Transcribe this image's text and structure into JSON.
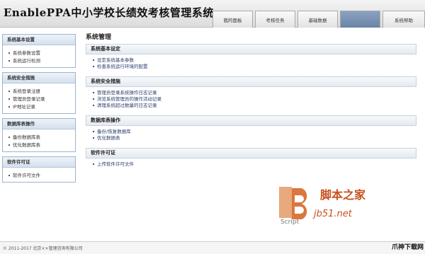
{
  "header": {
    "title": "EnablePPA中小学校长绩效考核管理系统",
    "tabs": [
      {
        "label": "我的面板",
        "active": false
      },
      {
        "label": "考核任务",
        "active": false
      },
      {
        "label": "基础数据",
        "active": false
      },
      {
        "label": "",
        "active": true
      },
      {
        "label": "系统帮助",
        "active": false
      }
    ]
  },
  "sidebar": {
    "groups": [
      {
        "title": "系统基本设置",
        "items": [
          "系统参数设置",
          "系统运行检测"
        ]
      },
      {
        "title": "系统安全措施",
        "items": [
          "系统登录注册",
          "管理员登录记录",
          "IP地址记录"
        ]
      },
      {
        "title": "数据库表操作",
        "items": [
          "备份数据库表",
          "优化数据库表"
        ]
      },
      {
        "title": "软件许可证",
        "items": [
          "软件许可文件"
        ]
      }
    ]
  },
  "main": {
    "title": "系统管理",
    "sections": [
      {
        "title": "系统基本设定",
        "items": [
          "设定系统基本参数",
          "检查系统运行环境的配置"
        ]
      },
      {
        "title": "系统安全措施",
        "items": [
          "管理员登录系统操作日志记录",
          "浏览系统管理员的操作活动记录",
          "清理系统超过数量的日志记录"
        ]
      },
      {
        "title": "数据库表操作",
        "items": [
          "备份/恢复数据库",
          "优化数据表"
        ]
      },
      {
        "title": "软件许可证",
        "items": [
          "上传软件许可文件"
        ]
      }
    ]
  },
  "footer": {
    "copyright": "© 2011-2017 北京××管理咨询有限公司"
  },
  "watermark": {
    "brand": "脚本之家",
    "url": "jb51.net",
    "logo_text": "Script",
    "corner": "爪神下载网"
  },
  "colors": {
    "active_tab": "#7892b3",
    "link": "#2a3d6c",
    "watermark": "#c8501f"
  }
}
